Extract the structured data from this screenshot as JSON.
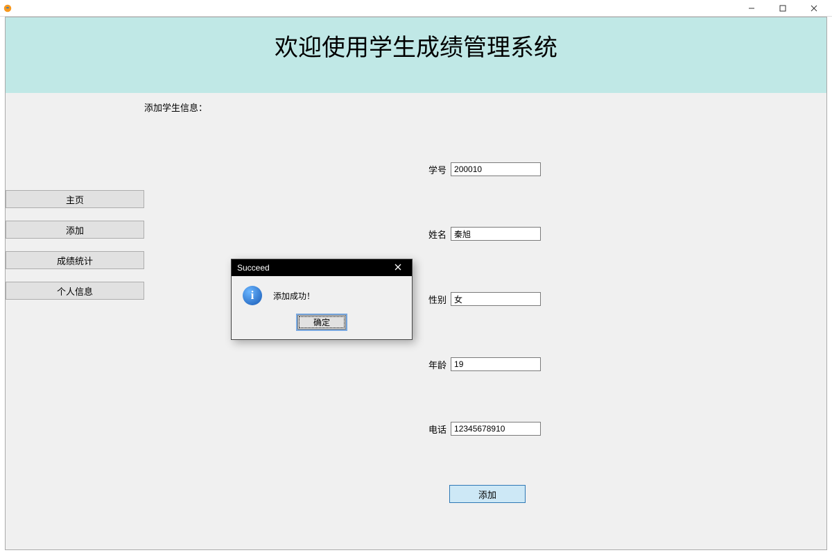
{
  "window": {
    "title": ""
  },
  "titlebar_controls": {
    "minimize": "—",
    "maximize": "☐",
    "close": "✕"
  },
  "header": {
    "title": "欢迎使用学生成绩管理系统"
  },
  "section": {
    "label": "添加学生信息："
  },
  "sidebar": {
    "items": [
      {
        "label": "主页"
      },
      {
        "label": "添加"
      },
      {
        "label": "成绩统计"
      },
      {
        "label": "个人信息"
      }
    ]
  },
  "form": {
    "student_id": {
      "label": "学号",
      "value": "200010"
    },
    "name": {
      "label": "姓名",
      "value": "秦旭"
    },
    "gender": {
      "label": "性别",
      "value": "女"
    },
    "age": {
      "label": "年龄",
      "value": "19"
    },
    "phone": {
      "label": "电话",
      "value": "12345678910"
    },
    "submit_label": "添加"
  },
  "modal": {
    "title": "Succeed",
    "message": "添加成功！",
    "ok_label": "确定",
    "close_glyph": "✕"
  }
}
